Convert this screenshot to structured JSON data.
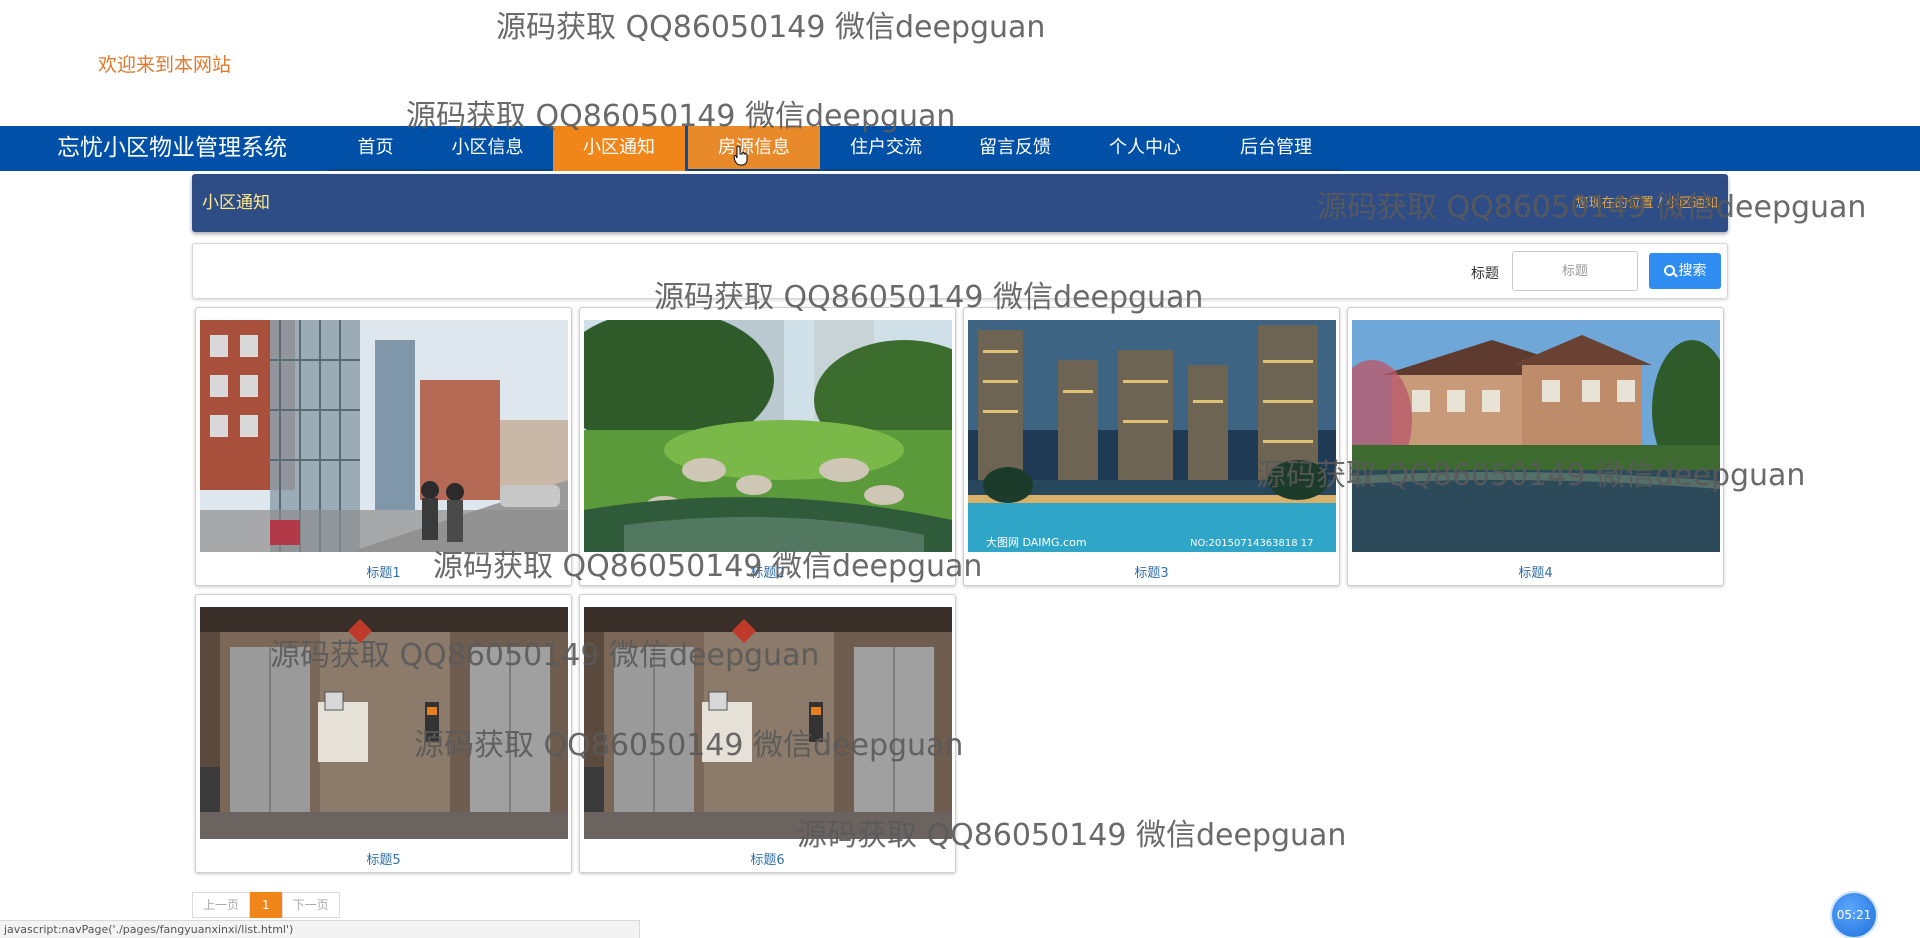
{
  "header": {
    "welcome": "欢迎来到本网站"
  },
  "navbar": {
    "brand": "忘忧小区物业管理系统",
    "items": [
      {
        "label": "首页"
      },
      {
        "label": "小区信息"
      },
      {
        "label": "小区通知"
      },
      {
        "label": "房源信息"
      },
      {
        "label": "住户交流"
      },
      {
        "label": "留言反馈"
      },
      {
        "label": "个人中心"
      },
      {
        "label": "后台管理"
      }
    ],
    "active": "小区通知",
    "hovered": "房源信息"
  },
  "section": {
    "title": "小区通知",
    "breadcrumb": [
      "您现在的位置",
      "小区通知"
    ]
  },
  "search": {
    "label": "标题",
    "placeholder": "标题",
    "button": "搜索"
  },
  "cards": [
    {
      "title": "标题1",
      "image": "residential-elevator-outdoor"
    },
    {
      "title": "标题2",
      "image": "garden-pond"
    },
    {
      "title": "标题3",
      "image": "night-towers-pool"
    },
    {
      "title": "标题4",
      "image": "villa-lake"
    },
    {
      "title": "标题5",
      "image": "elevator-lobby"
    },
    {
      "title": "标题6",
      "image": "elevator-lobby"
    }
  ],
  "image_texts": {
    "card3_left": "大图网 DAIMG.com",
    "card3_right": "NO:20150714363818 17"
  },
  "pagination": {
    "prev": "上一页",
    "current": "1",
    "next": "下一页"
  },
  "statusbar": "javascript:navPage('./pages/fangyuanxinxi/list.html')",
  "clock": "05:21",
  "watermark": "源码获取 QQ86050149 微信deepguan",
  "colors": {
    "navbar": "#0050a8",
    "accent": "#f08519",
    "section_bar": "#2e4d86",
    "search_button": "#2f8cf0",
    "welcome": "#e07a2e"
  }
}
